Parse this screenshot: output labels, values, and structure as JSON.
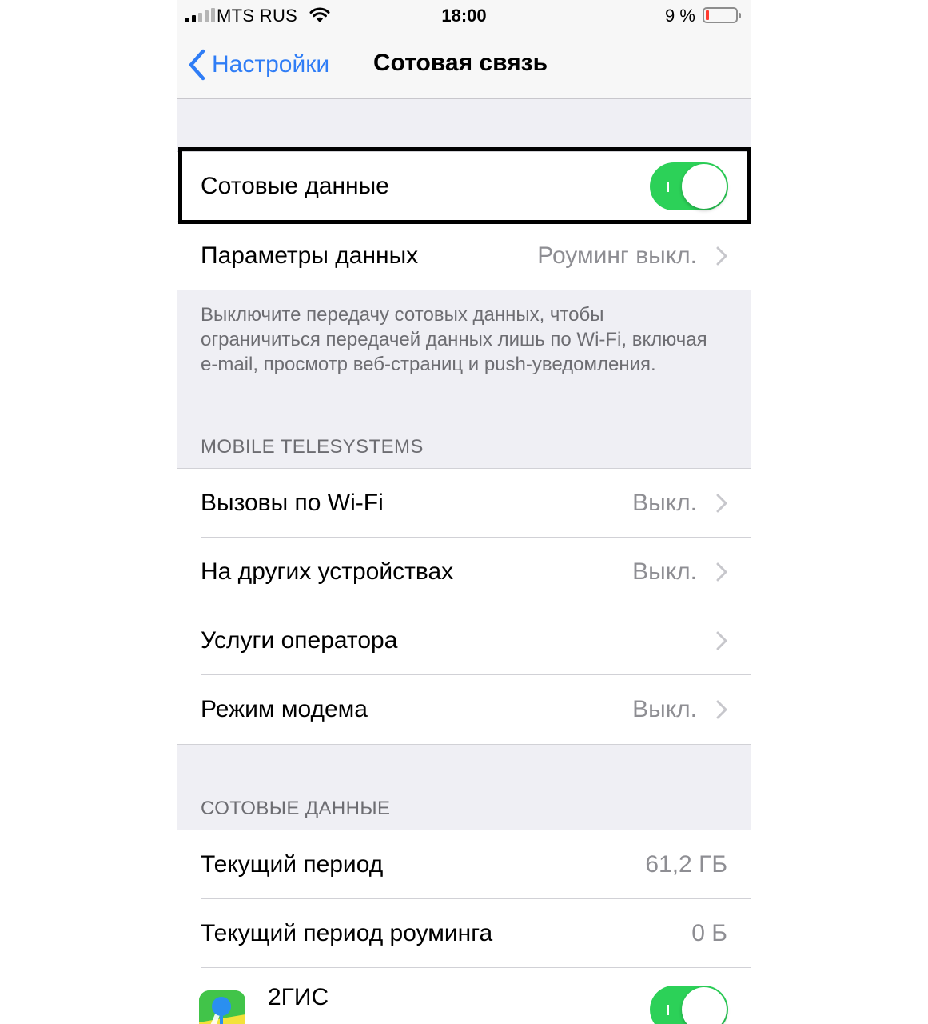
{
  "status_bar": {
    "carrier": "MTS RUS",
    "time": "18:00",
    "battery_percent": "9 %",
    "battery_level": 0.09,
    "signal_bars_filled": 2,
    "signal_bars_total": 5
  },
  "nav": {
    "back_label": "Настройки",
    "title": "Сотовая связь"
  },
  "cellular_data": {
    "label": "Сотовые данные",
    "enabled": true
  },
  "data_options": {
    "label": "Параметры данных",
    "value": "Роуминг выкл."
  },
  "footer_note": "Выключите передачу сотовых данных, чтобы ограничиться передачей данных лишь по Wi-Fi, включая e-mail, просмотр веб-страниц и push-уведомления.",
  "carrier_section": {
    "header": "MOBILE TELESYSTEMS",
    "items": [
      {
        "label": "Вызовы по Wi-Fi",
        "value": "Выкл."
      },
      {
        "label": "На других устройствах",
        "value": "Выкл."
      },
      {
        "label": "Услуги оператора",
        "value": ""
      },
      {
        "label": "Режим модема",
        "value": "Выкл."
      }
    ]
  },
  "usage_section": {
    "header": "СОТОВЫЕ ДАННЫЕ",
    "items": [
      {
        "label": "Текущий период",
        "value": "61,2 ГБ"
      },
      {
        "label": "Текущий период роуминга",
        "value": "0 Б"
      }
    ]
  },
  "apps": [
    {
      "name": "2ГИС",
      "enabled": true
    }
  ],
  "colors": {
    "accent_blue": "#2f7df6",
    "toggle_green": "#2cd158",
    "battery_low": "#ff3b30",
    "grouped_background": "#efeff4"
  }
}
